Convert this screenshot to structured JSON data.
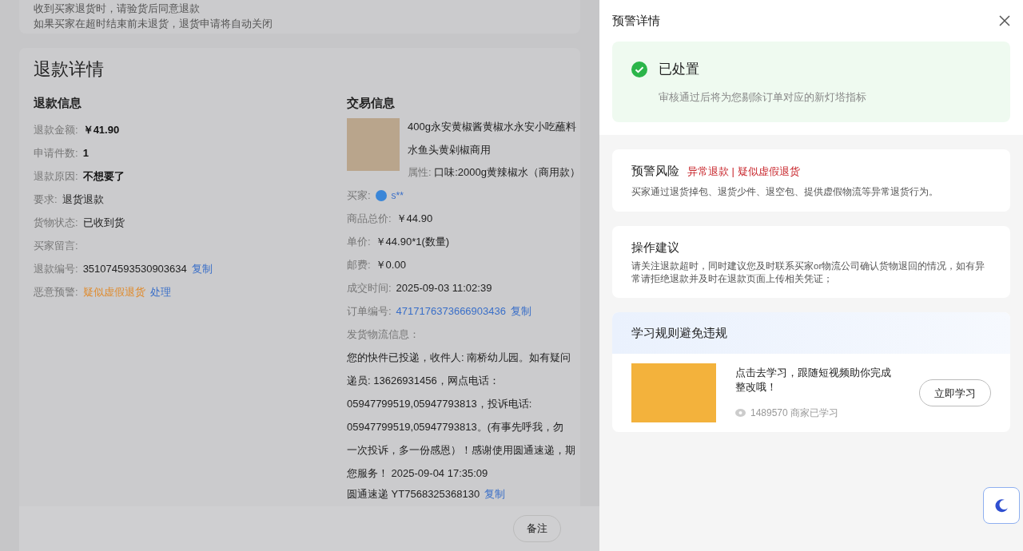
{
  "notice": {
    "lines": [
      "收到买家退货时，请验货后同意退款",
      "如果买家在超时结束前未退货，退货申请将自动关闭"
    ]
  },
  "refund_detail": {
    "title": "退款详情",
    "refund_info": {
      "heading": "退款信息",
      "fields": [
        {
          "label": "退款金额:",
          "value": "￥41.90",
          "kind": "bold"
        },
        {
          "label": "申请件数:",
          "value": "1",
          "kind": "bold"
        },
        {
          "label": "退款原因:",
          "value": "不想要了",
          "kind": "bold"
        },
        {
          "label": "要求:",
          "value": "退货退款",
          "kind": "plain"
        },
        {
          "label": "货物状态:",
          "value": "已收到货",
          "kind": "plain"
        },
        {
          "label": "买家留言:"
        },
        {
          "label": "退款编号:",
          "value": "351074593530903634",
          "kind": "plain",
          "action": "复制"
        },
        {
          "label": "恶意预警:",
          "value": "疑似虚假退货",
          "kind": "warning",
          "action": "处理"
        }
      ]
    },
    "trade_info": {
      "heading": "交易信息",
      "product": {
        "title_lines": [
          "400g永安黄椒酱黄椒水永安小吃蘸料",
          "水鱼头黄剁椒商用"
        ],
        "attribute_label": "属性:",
        "attribute": "口味:2000g黄辣椒水（商用款）"
      },
      "buyer": {
        "label": "买家:",
        "name": "s**"
      },
      "fields": [
        {
          "label": "商品总价:",
          "value": "￥44.90",
          "kind": "plain"
        },
        {
          "label": "单价:",
          "value": "￥44.90*1(数量)",
          "kind": "plain"
        },
        {
          "label": "邮费:",
          "value": "￥0.00",
          "kind": "plain"
        },
        {
          "label": "成交时间:",
          "value": "2025-09-03 11:02:39",
          "kind": "plain"
        },
        {
          "label": "订单编号:",
          "value": "4717176373666903436",
          "kind": "link",
          "action": "复制"
        }
      ],
      "logistics_label": "发货物流信息：",
      "logistics_lines": [
        "您的快件已投递，收件人: 南桥幼儿园。如有疑问",
        "递员: 13626931456，网点电话：",
        "05947799519,05947793813，投诉电话:",
        "05947799519,05947793813。(有事先呼我，勿",
        "一次投诉，多一份感恩）！感谢使用圆通速递，期",
        "您服务！ 2025-09-04 17:35:09"
      ],
      "tracking": {
        "value": "圆通速递 YT7568325368130",
        "action": "复制"
      }
    }
  },
  "footer": {
    "button": "备注"
  },
  "drawer": {
    "title": "预警详情",
    "status": {
      "title": "已处置",
      "description": "审核通过后将为您剔除订单对应的新灯塔指标",
      "resolved": true
    },
    "risk": {
      "title": "预警风险",
      "tags": "异常退款 | 疑似虚假退货",
      "description": "买家通过退货掉包、退货少件、退空包、提供虚假物流等异常退货行为。"
    },
    "advice": {
      "title": "操作建议",
      "description": "请关注退款超时，同时建议您及时联系买家or物流公司确认货物退回的情况，如有异常请拒绝退款并及时在退款页面上传相关凭证；"
    },
    "learning": {
      "title": "学习规则避免违规",
      "text": "点击去学习，跟随短视频助你完成整改哦！",
      "views": "1489570 商家已学习",
      "button": "立即学习"
    }
  }
}
